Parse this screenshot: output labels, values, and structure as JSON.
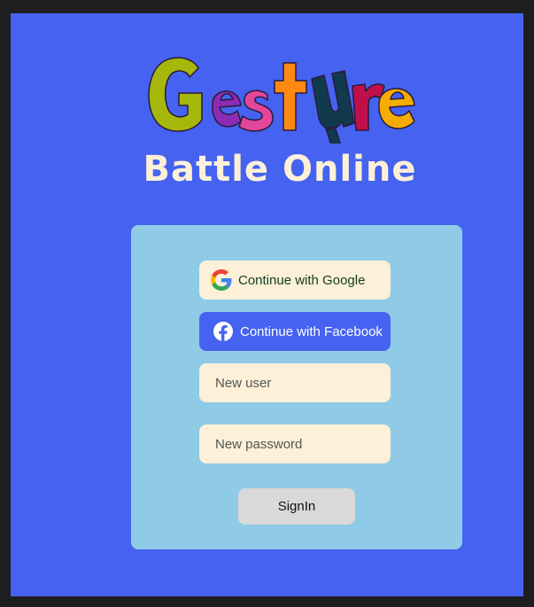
{
  "app": {
    "logo_text": "Gesture",
    "subtitle": "Battle Online"
  },
  "auth": {
    "google_label": "Continue with Google",
    "google_icon": "google-icon",
    "facebook_label": "Continue with Facebook",
    "facebook_icon": "facebook-icon",
    "username_placeholder": "New user",
    "password_placeholder": "New password",
    "signin_label": "SignIn"
  },
  "colors": {
    "background": "#4563f0",
    "card": "#8fcae7",
    "cream": "#fdf0d8",
    "signin_button": "#d9d9d9"
  }
}
